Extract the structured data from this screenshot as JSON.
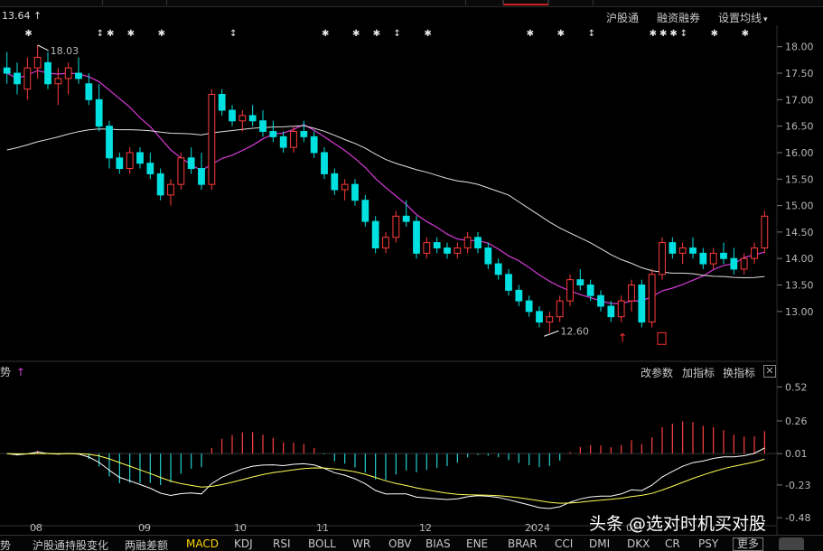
{
  "header": {
    "price_readout": "13.64",
    "up_arrow": "↑",
    "links": {
      "shanghai_connect": "沪股通",
      "margin": "融资融券",
      "ma_settings": "设置均线",
      "ma_settings_caret": "▾"
    }
  },
  "sub_panel": {
    "left_label": "势",
    "left_arrow": "↑",
    "actions": {
      "edit_params": "改参数",
      "add_indicator": "加指标",
      "switch_indicator": "换指标",
      "close": "✕"
    }
  },
  "bottom_tabs": [
    "趋势",
    "沪股通持股变化",
    "两融差额",
    "MACD",
    "KDJ",
    "RSI",
    "BOLL",
    "WR",
    "OBV",
    "BIAS",
    "ENE",
    "BRAR",
    "CCI",
    "DMI",
    "DKX",
    "CR",
    "PSY"
  ],
  "bottom_tabs_display": [
    "趋势",
    "沪股通持股变化",
    "两融差额",
    "MACD",
    "KDJ",
    "RSI",
    "BOLL",
    "WR",
    "OBV",
    "BIAS",
    "ENE",
    "BRAR",
    "CCI",
    "DMI",
    "DKX",
    "CR",
    "PSY"
  ],
  "active_tab": "MACD",
  "more_button": "更多",
  "watermark": "头条 @选对时机买对股",
  "chart_data": {
    "type": "candlestick",
    "price_axis": {
      "ylim": [
        12.4,
        18.2
      ],
      "ticks": [
        "18.00",
        "17.50",
        "17.00",
        "16.50",
        "16.00",
        "15.50",
        "15.00",
        "14.50",
        "14.00",
        "13.50",
        "13.00"
      ]
    },
    "macd_axis": {
      "ylim": [
        -0.5,
        0.55
      ],
      "ticks": [
        "0.52",
        "0.26",
        "0.01",
        "-0.23",
        "-0.48"
      ]
    },
    "x_ticks": [
      "08",
      "09",
      "10",
      "11",
      "12",
      "2024",
      "02"
    ],
    "annotations": {
      "high": "18.03",
      "low": "12.60"
    },
    "ohlc": [
      [
        17.6,
        17.9,
        17.3,
        17.5
      ],
      [
        17.5,
        17.7,
        17.1,
        17.3
      ],
      [
        17.2,
        17.8,
        17.0,
        17.6
      ],
      [
        17.6,
        18.03,
        17.4,
        17.8
      ],
      [
        17.7,
        17.9,
        17.2,
        17.3
      ],
      [
        17.3,
        17.6,
        16.9,
        17.4
      ],
      [
        17.4,
        17.7,
        17.1,
        17.6
      ],
      [
        17.5,
        17.8,
        17.3,
        17.4
      ],
      [
        17.3,
        17.5,
        16.9,
        17.0
      ],
      [
        17.0,
        17.3,
        16.4,
        16.5
      ],
      [
        16.5,
        16.6,
        15.7,
        15.9
      ],
      [
        15.9,
        16.0,
        15.6,
        15.7
      ],
      [
        15.7,
        16.1,
        15.6,
        16.0
      ],
      [
        16.0,
        16.1,
        15.7,
        15.8
      ],
      [
        15.8,
        16.0,
        15.5,
        15.6
      ],
      [
        15.6,
        15.7,
        15.1,
        15.2
      ],
      [
        15.2,
        15.5,
        15.0,
        15.4
      ],
      [
        15.4,
        16.0,
        15.3,
        15.9
      ],
      [
        15.9,
        16.1,
        15.6,
        15.7
      ],
      [
        15.7,
        16.0,
        15.3,
        15.4
      ],
      [
        15.4,
        17.2,
        15.3,
        17.1
      ],
      [
        17.1,
        17.2,
        16.7,
        16.8
      ],
      [
        16.8,
        16.9,
        16.5,
        16.6
      ],
      [
        16.6,
        16.8,
        16.4,
        16.7
      ],
      [
        16.7,
        16.9,
        16.5,
        16.6
      ],
      [
        16.6,
        16.8,
        16.3,
        16.4
      ],
      [
        16.4,
        16.6,
        16.2,
        16.3
      ],
      [
        16.3,
        16.4,
        16.0,
        16.1
      ],
      [
        16.1,
        16.5,
        16.0,
        16.4
      ],
      [
        16.4,
        16.6,
        16.2,
        16.3
      ],
      [
        16.3,
        16.4,
        15.9,
        16.0
      ],
      [
        16.0,
        16.1,
        15.5,
        15.6
      ],
      [
        15.6,
        15.7,
        15.2,
        15.3
      ],
      [
        15.3,
        15.5,
        15.1,
        15.4
      ],
      [
        15.4,
        15.5,
        15.0,
        15.1
      ],
      [
        15.1,
        15.2,
        14.6,
        14.7
      ],
      [
        14.7,
        14.8,
        14.1,
        14.2
      ],
      [
        14.2,
        14.5,
        14.1,
        14.4
      ],
      [
        14.4,
        14.9,
        14.3,
        14.8
      ],
      [
        14.8,
        15.1,
        14.6,
        14.7
      ],
      [
        14.7,
        14.8,
        14.0,
        14.1
      ],
      [
        14.1,
        14.4,
        14.0,
        14.3
      ],
      [
        14.3,
        14.4,
        14.1,
        14.2
      ],
      [
        14.2,
        14.3,
        14.0,
        14.1
      ],
      [
        14.1,
        14.3,
        14.0,
        14.2
      ],
      [
        14.2,
        14.5,
        14.1,
        14.4
      ],
      [
        14.4,
        14.5,
        14.1,
        14.2
      ],
      [
        14.2,
        14.3,
        13.8,
        13.9
      ],
      [
        13.9,
        14.0,
        13.6,
        13.7
      ],
      [
        13.7,
        13.8,
        13.3,
        13.4
      ],
      [
        13.4,
        13.5,
        13.1,
        13.2
      ],
      [
        13.2,
        13.3,
        12.9,
        13.0
      ],
      [
        13.0,
        13.1,
        12.7,
        12.8
      ],
      [
        12.8,
        13.0,
        12.6,
        12.9
      ],
      [
        12.9,
        13.3,
        12.8,
        13.2
      ],
      [
        13.2,
        13.7,
        13.1,
        13.6
      ],
      [
        13.6,
        13.8,
        13.4,
        13.5
      ],
      [
        13.5,
        13.6,
        13.2,
        13.3
      ],
      [
        13.3,
        13.4,
        13.0,
        13.1
      ],
      [
        13.1,
        13.2,
        12.8,
        12.9
      ],
      [
        12.9,
        13.3,
        12.8,
        13.2
      ],
      [
        13.2,
        13.6,
        13.0,
        13.5
      ],
      [
        13.5,
        13.6,
        12.7,
        12.8
      ],
      [
        12.8,
        13.8,
        12.7,
        13.7
      ],
      [
        13.7,
        14.4,
        13.6,
        14.3
      ],
      [
        14.3,
        14.4,
        14.0,
        14.1
      ],
      [
        14.1,
        14.3,
        13.9,
        14.2
      ],
      [
        14.2,
        14.4,
        14.0,
        14.1
      ],
      [
        14.1,
        14.2,
        13.8,
        13.9
      ],
      [
        13.9,
        14.2,
        13.8,
        14.1
      ],
      [
        14.1,
        14.3,
        13.9,
        14.0
      ],
      [
        14.0,
        14.2,
        13.7,
        13.8
      ],
      [
        13.8,
        14.1,
        13.7,
        14.0
      ],
      [
        14.0,
        14.3,
        13.9,
        14.2
      ],
      [
        14.2,
        14.9,
        14.1,
        14.8
      ]
    ]
  }
}
